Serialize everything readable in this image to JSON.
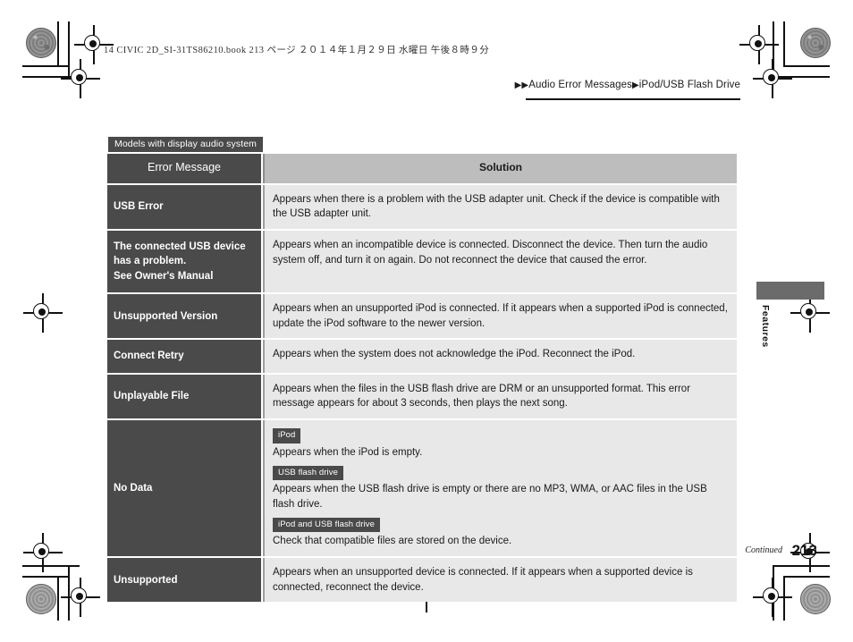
{
  "print_header": {
    "book_line": "14 CIVIC 2D_SI-31TS86210.book   213 ページ   ２０１４年１月２９日   水曜日   午後８時９分"
  },
  "breadcrumb": {
    "marker1": "▶",
    "marker2": "▶",
    "section": "Audio Error Messages",
    "marker3": "▶",
    "subsection": "iPod/USB Flash Drive"
  },
  "side_tab": {
    "label": "Features"
  },
  "model_badge": "Models with display audio system",
  "table": {
    "headers": {
      "error_message": "Error Message",
      "solution": "Solution"
    },
    "rows": [
      {
        "error": "USB Error",
        "solution": "Appears when there is a problem with the USB adapter unit. Check if the device is compatible with the USB adapter unit."
      },
      {
        "error": "The connected USB device has a problem.\nSee Owner's Manual",
        "solution": "Appears when an incompatible device is connected. Disconnect the device. Then turn the audio system off, and turn it on again. Do not reconnect the device that caused the error."
      },
      {
        "error": "Unsupported Version",
        "solution": "Appears when an unsupported iPod is connected. If it appears when a supported iPod is connected, update the iPod software to the newer version."
      },
      {
        "error": "Connect Retry",
        "solution": "Appears when the system does not acknowledge the iPod. Reconnect the iPod."
      },
      {
        "error": "Unplayable File",
        "solution": "Appears when the files in the USB flash drive are DRM or an unsupported format. This error message appears for about 3 seconds, then plays the next song."
      },
      {
        "error": "No Data",
        "solution_blocks": [
          {
            "badge": "iPod",
            "text": "Appears when the iPod is empty."
          },
          {
            "badge": "USB flash drive",
            "text": "Appears when the USB flash drive is empty or there are no MP3, WMA, or AAC files in the USB flash drive."
          },
          {
            "badge": "iPod and USB flash drive",
            "text": "Check that compatible files are stored on the device."
          }
        ]
      },
      {
        "error": "Unsupported",
        "solution": "Appears when an unsupported device is connected. If it appears when a supported device is connected, reconnect the device."
      }
    ]
  },
  "footer": {
    "continued": "Continued",
    "page_number": "213"
  },
  "colors": {
    "dark_gray": "#4a4a4a",
    "header_gray": "#bdbdbd",
    "cell_gray": "#e8e8e8",
    "tab_gray": "#6b6b6b"
  }
}
